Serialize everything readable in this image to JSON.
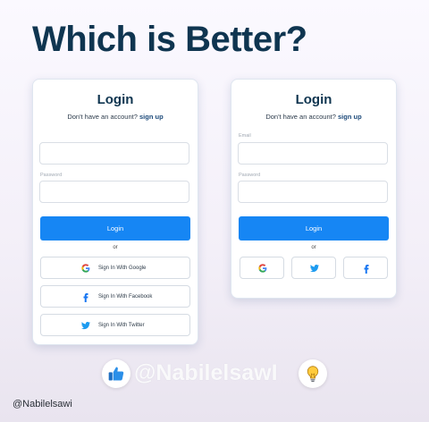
{
  "headline": "Which is Better?",
  "card1": {
    "title": "Login",
    "subtitle_text": "Don't have an account?",
    "signup_link": "sign up",
    "email_label": "",
    "password_label": "Password",
    "login_button": "Login",
    "or_text": "or",
    "social_buttons": [
      {
        "label": "Sign In With Google",
        "icon": "google-icon"
      },
      {
        "label": "Sign In With Facebook",
        "icon": "facebook-icon"
      },
      {
        "label": "Sign In With Twitter",
        "icon": "twitter-icon"
      }
    ]
  },
  "card2": {
    "title": "Login",
    "subtitle_text": "Don't have an account?",
    "signup_link": "sign up",
    "email_label": "Email",
    "password_label": "Password",
    "login_button": "Login",
    "or_text": "or",
    "icon_buttons": [
      "google-icon",
      "twitter-icon",
      "facebook-icon"
    ]
  },
  "reactions": [
    "thumbs-up-icon",
    "lightbulb-icon"
  ],
  "watermark": "@NabilelsawI",
  "credit": "@Nabilelsawi",
  "colors": {
    "headline": "#0f3550",
    "primary_button": "#1686f4",
    "facebook": "#1877f2",
    "twitter": "#1d9bf0"
  }
}
